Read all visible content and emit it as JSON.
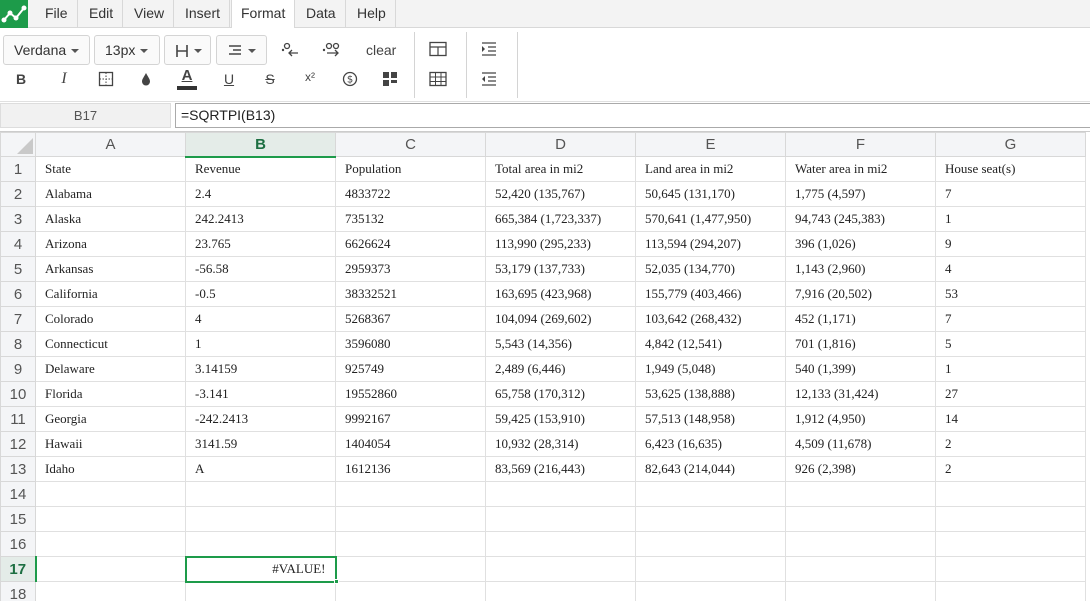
{
  "menu": [
    "File",
    "Edit",
    "View",
    "Insert",
    "Format",
    "Data",
    "Help"
  ],
  "menu_active": "Format",
  "toolbar": {
    "font_family": "Verdana",
    "font_size": "13px",
    "bold_label": "B",
    "italic_label": "I",
    "underline_label": "U",
    "strike_label": "S",
    "text_color_label": "A",
    "superscript_label": "x²",
    "clear_label": "clear"
  },
  "formula_bar": {
    "cell_ref": "B17",
    "formula": "=SQRTPI(B13)"
  },
  "columns": [
    "A",
    "B",
    "C",
    "D",
    "E",
    "F",
    "G"
  ],
  "selected": {
    "col": "B",
    "row": 17
  },
  "rows": [
    [
      "State",
      "Revenue",
      "Population",
      "Total area in mi2",
      "Land area in mi2",
      "Water area in mi2",
      "House seat(s)"
    ],
    [
      "Alabama",
      "2.4",
      "4833722",
      "52,420 (135,767)",
      "50,645 (131,170)",
      "1,775 (4,597)",
      "7"
    ],
    [
      "Alaska",
      "242.2413",
      "735132",
      "665,384 (1,723,337)",
      "570,641 (1,477,950)",
      "94,743 (245,383)",
      "1"
    ],
    [
      "Arizona",
      "23.765",
      "6626624",
      "113,990 (295,233)",
      "113,594 (294,207)",
      "396 (1,026)",
      "9"
    ],
    [
      "Arkansas",
      "-56.58",
      "2959373",
      "53,179 (137,733)",
      "52,035 (134,770)",
      "1,143 (2,960)",
      "4"
    ],
    [
      "California",
      "-0.5",
      "38332521",
      "163,695 (423,968)",
      "155,779 (403,466)",
      "7,916 (20,502)",
      "53"
    ],
    [
      "Colorado",
      "4",
      "5268367",
      "104,094 (269,602)",
      "103,642 (268,432)",
      "452 (1,171)",
      "7"
    ],
    [
      "Connecticut",
      "1",
      "3596080",
      "5,543 (14,356)",
      "4,842 (12,541)",
      "701 (1,816)",
      "5"
    ],
    [
      "Delaware",
      "3.14159",
      "925749",
      "2,489 (6,446)",
      "1,949 (5,048)",
      "540 (1,399)",
      "1"
    ],
    [
      "Florida",
      "-3.141",
      "19552860",
      "65,758 (170,312)",
      "53,625 (138,888)",
      "12,133 (31,424)",
      "27"
    ],
    [
      "Georgia",
      "-242.2413",
      "9992167",
      "59,425 (153,910)",
      "57,513 (148,958)",
      "1,912 (4,950)",
      "14"
    ],
    [
      "Hawaii",
      "3141.59",
      "1404054",
      "10,932 (28,314)",
      "6,423 (16,635)",
      "4,509 (11,678)",
      "2"
    ],
    [
      "Idaho",
      "A",
      "1612136",
      "83,569 (216,443)",
      "82,643 (214,044)",
      "926 (2,398)",
      "2"
    ],
    [
      "",
      "",
      "",
      "",
      "",
      "",
      ""
    ],
    [
      "",
      "",
      "",
      "",
      "",
      "",
      ""
    ],
    [
      "",
      "",
      "",
      "",
      "",
      "",
      ""
    ],
    [
      "",
      "#VALUE!",
      "",
      "",
      "",
      "",
      ""
    ],
    [
      "",
      "",
      "",
      "",
      "",
      "",
      ""
    ]
  ],
  "colors": {
    "accent": "#1d9b4a",
    "header_bg": "#f4f5f7"
  }
}
